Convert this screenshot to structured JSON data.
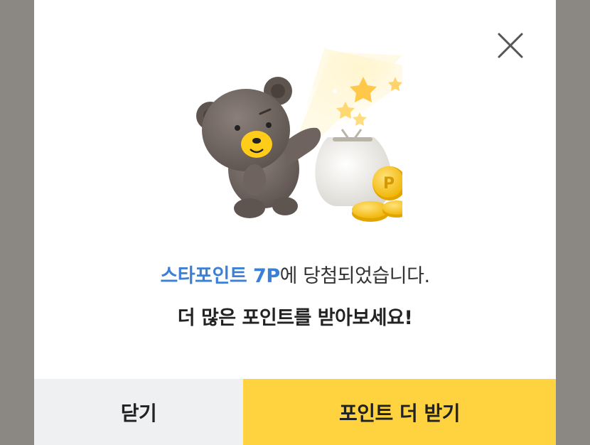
{
  "dialog": {
    "message_highlight": "스타포인트 7P",
    "message_rest": "에 당첨되었습니다.",
    "sub_message": "더 많은 포인트를 받아보세요!",
    "close_label": "닫기",
    "more_points_label": "포인트 더 받기"
  },
  "colors": {
    "accent_blue": "#3c7fd6",
    "button_yellow": "#ffd23f",
    "button_gray": "#eef0f2",
    "overlay": "#8b8782"
  },
  "icons": {
    "close": "close-icon",
    "illustration": "bear-with-points-illustration",
    "coin_letter": "P"
  }
}
